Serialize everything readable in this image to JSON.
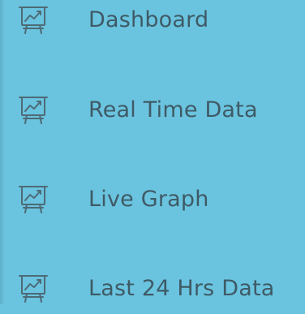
{
  "sidebar": {
    "items": [
      {
        "label": "Dashboard",
        "icon": "presentation-chart-icon"
      },
      {
        "label": "Real Time Data",
        "icon": "presentation-chart-icon"
      },
      {
        "label": "Live Graph",
        "icon": "presentation-chart-icon"
      },
      {
        "label": "Last 24 Hrs Data",
        "icon": "presentation-chart-icon"
      }
    ]
  },
  "colors": {
    "background": "#6ac4df",
    "text": "#3f5a66"
  }
}
